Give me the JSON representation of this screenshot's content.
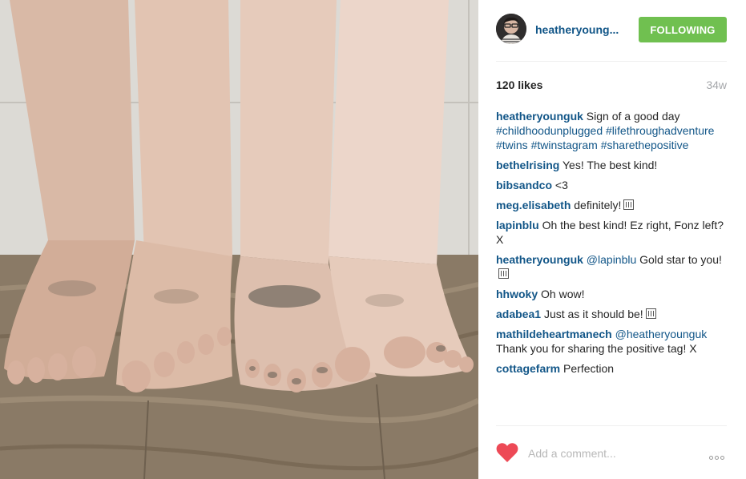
{
  "post": {
    "photo_alt": "photo-feet"
  },
  "header": {
    "username": "heatheryoung...",
    "follow_label": "FOLLOWING",
    "follow_color": "#70c050"
  },
  "stats": {
    "likes": "120 likes",
    "time": "34w"
  },
  "caption": {
    "user": "heatheryounguk",
    "text": "Sign of a good day",
    "hashtags": "#childhoodunplugged #lifethroughadventure #twins #twinstagram #sharethepositive"
  },
  "comments": [
    {
      "user": "bethelrising",
      "text": "Yes! The best kind!"
    },
    {
      "user": "bibsandco",
      "text": "<3"
    },
    {
      "user": "meg.elisabeth",
      "text": "definitely!",
      "emoji": true
    },
    {
      "user": "lapinblu",
      "text": "Oh the best kind! Ez right, Fonz left? X"
    },
    {
      "user": "heatheryounguk",
      "mention": "@lapinblu",
      "text": "Gold star to you!",
      "emoji": true
    },
    {
      "user": "hhwoky",
      "text": "Oh wow!"
    },
    {
      "user": "adabea1",
      "text": "Just as it should be!",
      "emoji": true
    },
    {
      "user": "mathildeheartmanech",
      "mention": "@heatheryounguk",
      "text": "Thank you for sharing the positive tag! X"
    },
    {
      "user": "cottagefarm",
      "text": "Perfection"
    }
  ],
  "footer": {
    "comment_placeholder": "Add a comment...",
    "like_icon": "heart-icon",
    "more_icon": "more-options-icon",
    "heart_color": "#ed4956"
  },
  "colors": {
    "link": "#125688",
    "text": "#262626",
    "muted": "#a5a7aa"
  }
}
